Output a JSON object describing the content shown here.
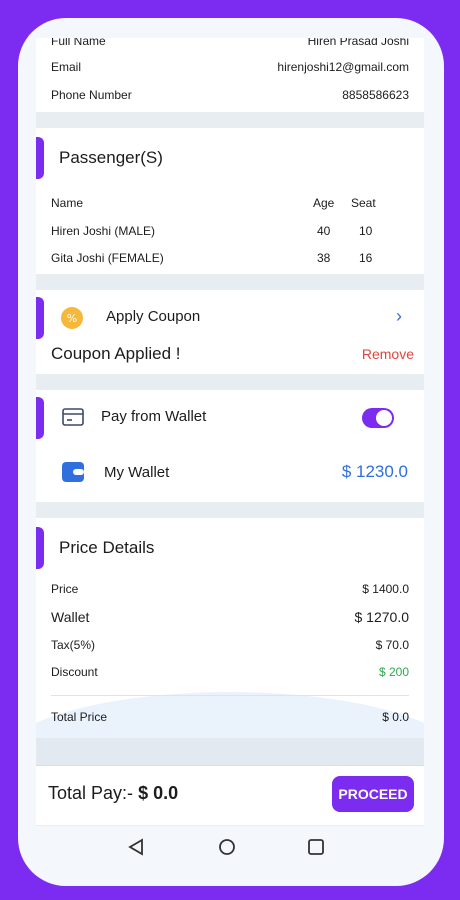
{
  "contact": {
    "full_name_label": "Full Name",
    "full_name_value": "Hiren Prasad Joshi",
    "email_label": "Email",
    "email_value": "hirenjoshi12@gmail.com",
    "phone_label": "Phone Number",
    "phone_value": "8858586623"
  },
  "passengers": {
    "title": "Passenger(S)",
    "columns": [
      "Name",
      "Age",
      "Seat"
    ],
    "rows": [
      {
        "name": "Hiren Joshi (MALE)",
        "age": "40",
        "seat": "10"
      },
      {
        "name": "Gita Joshi  (FEMALE)",
        "age": "38",
        "seat": "16"
      }
    ]
  },
  "coupon": {
    "title": "Apply Coupon",
    "applied": "Coupon Applied !",
    "remove": "Remove"
  },
  "wallet": {
    "title": "Pay from Wallet",
    "toggle_on": true,
    "my_wallet_label": "My Wallet",
    "my_wallet_amount": "$ 1230.0"
  },
  "price": {
    "title": "Price Details",
    "price_label": "Price",
    "price_value": "$ 1400.0",
    "wallet_label": "Wallet",
    "wallet_value": "$ 1270.0",
    "tax_label": "Tax(5%)",
    "tax_value": "$ 70.0",
    "discount_label": "Discount",
    "discount_value": "$ 200",
    "total_label": "Total Price",
    "total_value": "$ 0.0"
  },
  "footer": {
    "total_pay_label": "Total Pay:-",
    "total_pay_value": "$ 0.0",
    "proceed": "PROCEED"
  },
  "colors": {
    "accent": "#7b2cf0",
    "success": "#2ea84a",
    "danger": "#e0463e",
    "link": "#2f6fde"
  }
}
